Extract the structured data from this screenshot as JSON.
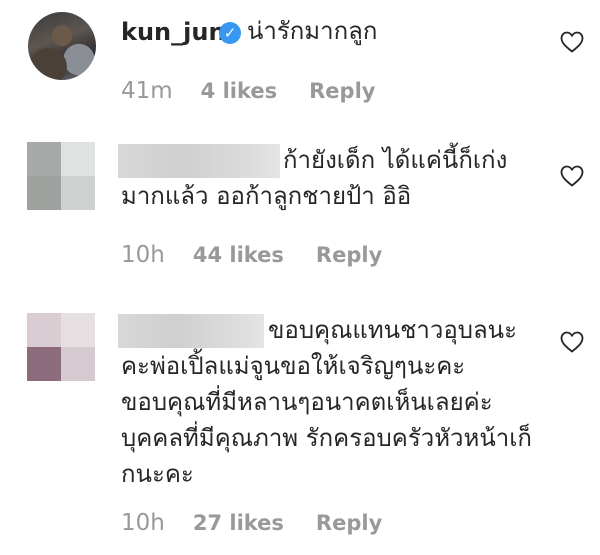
{
  "comments": [
    {
      "username": "kun_jun",
      "verified_icon": "check-icon",
      "text": "น่ารักมากลูก",
      "time": "41m",
      "likes": "4 likes",
      "reply": "Reply"
    },
    {
      "text_line1": "ก้ายังเด็ก ได้แค่นี้ก็เก่ง",
      "text_line2": "มากแล้ว ออก้าลูกชายป้า อิอิ",
      "time": "10h",
      "likes": "44 likes",
      "reply": "Reply",
      "avatar_colors": [
        "#a6a9a7",
        "#e0e2e1",
        "#9da29f",
        "#cfd1d0"
      ]
    },
    {
      "text_line1": "ขอบคุณแทนชาวอุบลนะ",
      "text_line2": "คะพ่อเปิ้ลแม่จูนขอให้เจริญๆนะคะ",
      "text_line3": "ขอบคุณที่มีหลานๆอนาคตเห็นเลยค่ะ",
      "text_line4": "บุคคลที่มีคุณภาพ รักครอบครัวหัวหน้าเก็",
      "text_line5": "กนะคะ",
      "time": "10h",
      "likes": "27 likes",
      "reply": "Reply",
      "avatar_colors": [
        "#d9cdd3",
        "#e5dfe2",
        "#8c6b7c",
        "#d4cacf"
      ]
    }
  ],
  "colors": {
    "text": "#262626",
    "meta": "#999999",
    "verified": "#3897f0"
  }
}
